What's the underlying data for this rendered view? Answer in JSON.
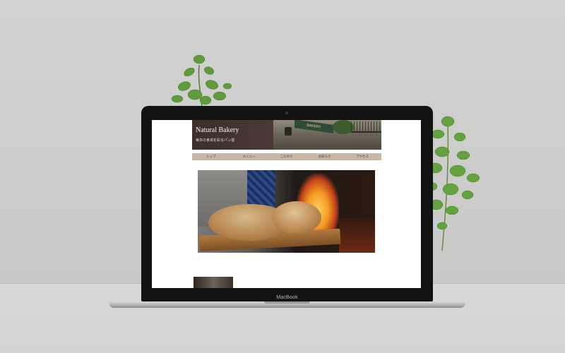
{
  "site": {
    "title": "Natural Bakery",
    "tagline": "毎日の食卓を彩るパン屋",
    "shop_sign": "BAKERY"
  },
  "nav": {
    "items": [
      "トップ",
      "メニュー",
      "こだわり",
      "お知らせ",
      "アクセス"
    ]
  },
  "laptop": {
    "brand_label": "MacBook"
  },
  "colors": {
    "header_bg": "#3b2e2b",
    "nav_bg": "#c9b6a7",
    "nav_text": "#4a3b33",
    "title_text": "#f4efe6"
  }
}
